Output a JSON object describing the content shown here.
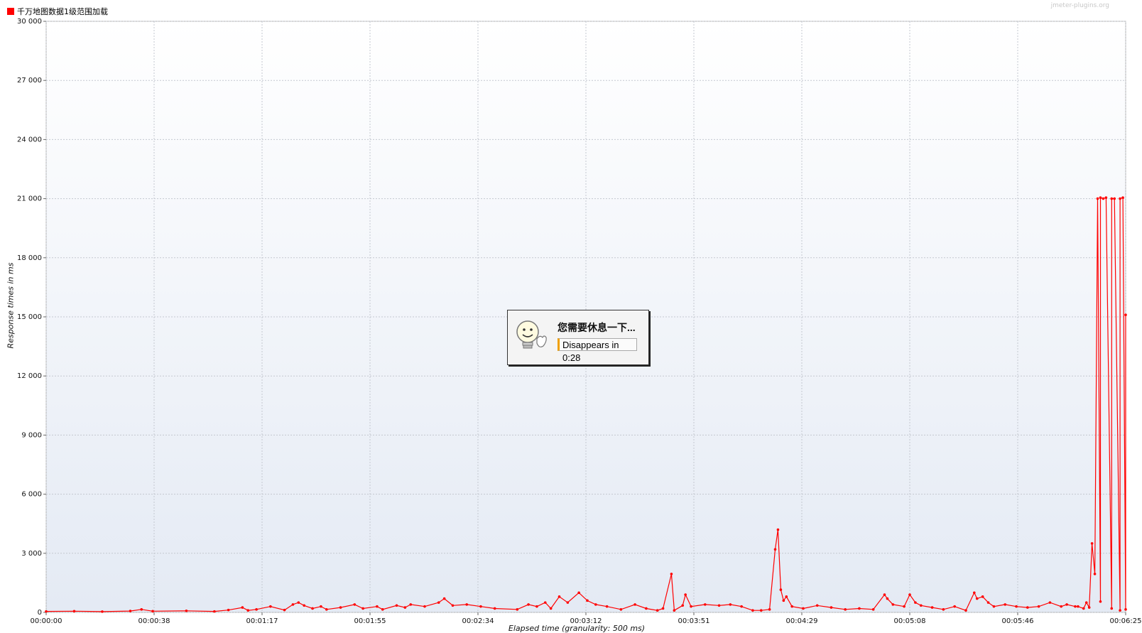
{
  "legend": {
    "label": "千万地图数据1级范围加载",
    "color": "#ff0000"
  },
  "watermark": "jmeter-plugins.org",
  "popup": {
    "title": "您需要休息一下...",
    "timer": "Disappears in 0:28"
  },
  "chart_data": {
    "type": "line",
    "title": "",
    "xlabel": "Elapsed time (granularity: 500 ms)",
    "ylabel": "Response times in ms",
    "x_tick_labels": [
      "00:00:00",
      "00:00:38",
      "00:01:17",
      "00:01:55",
      "00:02:34",
      "00:03:12",
      "00:03:51",
      "00:04:29",
      "00:05:08",
      "00:05:46",
      "00:06:25"
    ],
    "y_tick_labels": [
      "0",
      "3 000",
      "6 000",
      "9 000",
      "12 000",
      "15 000",
      "18 000",
      "21 000",
      "24 000",
      "27 000",
      "30 000"
    ],
    "xlim_seconds": [
      0,
      385
    ],
    "ylim": [
      0,
      30000
    ],
    "grid": true,
    "legend_position": "top-left",
    "series": [
      {
        "name": "千万地图数据1级范围加载",
        "color": "#ff0000",
        "points": [
          [
            0,
            50
          ],
          [
            10,
            60
          ],
          [
            20,
            40
          ],
          [
            30,
            70
          ],
          [
            34,
            150
          ],
          [
            38,
            60
          ],
          [
            50,
            80
          ],
          [
            60,
            50
          ],
          [
            65,
            120
          ],
          [
            70,
            250
          ],
          [
            72,
            100
          ],
          [
            75,
            150
          ],
          [
            80,
            300
          ],
          [
            85,
            120
          ],
          [
            88,
            400
          ],
          [
            90,
            500
          ],
          [
            92,
            350
          ],
          [
            95,
            200
          ],
          [
            98,
            300
          ],
          [
            100,
            150
          ],
          [
            105,
            250
          ],
          [
            110,
            400
          ],
          [
            113,
            200
          ],
          [
            118,
            300
          ],
          [
            120,
            150
          ],
          [
            125,
            350
          ],
          [
            128,
            250
          ],
          [
            130,
            400
          ],
          [
            135,
            300
          ],
          [
            140,
            500
          ],
          [
            142,
            700
          ],
          [
            145,
            350
          ],
          [
            150,
            400
          ],
          [
            155,
            300
          ],
          [
            160,
            200
          ],
          [
            168,
            150
          ],
          [
            172,
            400
          ],
          [
            175,
            300
          ],
          [
            178,
            500
          ],
          [
            180,
            200
          ],
          [
            183,
            800
          ],
          [
            186,
            500
          ],
          [
            190,
            1000
          ],
          [
            193,
            600
          ],
          [
            196,
            400
          ],
          [
            200,
            300
          ],
          [
            205,
            150
          ],
          [
            210,
            400
          ],
          [
            214,
            200
          ],
          [
            218,
            100
          ],
          [
            220,
            200
          ],
          [
            223,
            1950
          ],
          [
            224,
            100
          ],
          [
            227,
            350
          ],
          [
            228,
            900
          ],
          [
            230,
            300
          ],
          [
            235,
            400
          ],
          [
            240,
            350
          ],
          [
            244,
            400
          ],
          [
            248,
            300
          ],
          [
            252,
            100
          ],
          [
            255,
            100
          ],
          [
            258,
            150
          ],
          [
            260,
            3200
          ],
          [
            261,
            4200
          ],
          [
            262,
            1150
          ],
          [
            263,
            600
          ],
          [
            264,
            800
          ],
          [
            266,
            300
          ],
          [
            270,
            200
          ],
          [
            275,
            350
          ],
          [
            280,
            250
          ],
          [
            285,
            150
          ],
          [
            290,
            200
          ],
          [
            295,
            150
          ],
          [
            299,
            900
          ],
          [
            300,
            700
          ],
          [
            302,
            400
          ],
          [
            306,
            300
          ],
          [
            308,
            900
          ],
          [
            310,
            500
          ],
          [
            312,
            350
          ],
          [
            316,
            250
          ],
          [
            320,
            150
          ],
          [
            324,
            300
          ],
          [
            328,
            100
          ],
          [
            331,
            1000
          ],
          [
            332,
            700
          ],
          [
            334,
            800
          ],
          [
            336,
            500
          ],
          [
            338,
            300
          ],
          [
            342,
            400
          ],
          [
            346,
            300
          ],
          [
            350,
            250
          ],
          [
            354,
            300
          ],
          [
            358,
            500
          ],
          [
            362,
            300
          ],
          [
            364,
            400
          ],
          [
            368,
            300
          ],
          [
            372,
            250
          ],
          [
            376,
            550
          ],
          [
            380,
            200
          ],
          [
            383,
            100
          ],
          [
            385,
            150
          ],
          [
            367,
            300
          ],
          [
            370,
            200
          ],
          [
            371,
            500
          ],
          [
            373,
            3500
          ],
          [
            374,
            1950
          ],
          [
            375,
            21000
          ],
          [
            376,
            21050
          ],
          [
            377,
            21000
          ],
          [
            378,
            21050
          ],
          [
            380,
            21000
          ],
          [
            381,
            21000
          ],
          [
            383,
            21000
          ],
          [
            384,
            21050
          ],
          [
            385,
            15100
          ]
        ]
      }
    ]
  }
}
